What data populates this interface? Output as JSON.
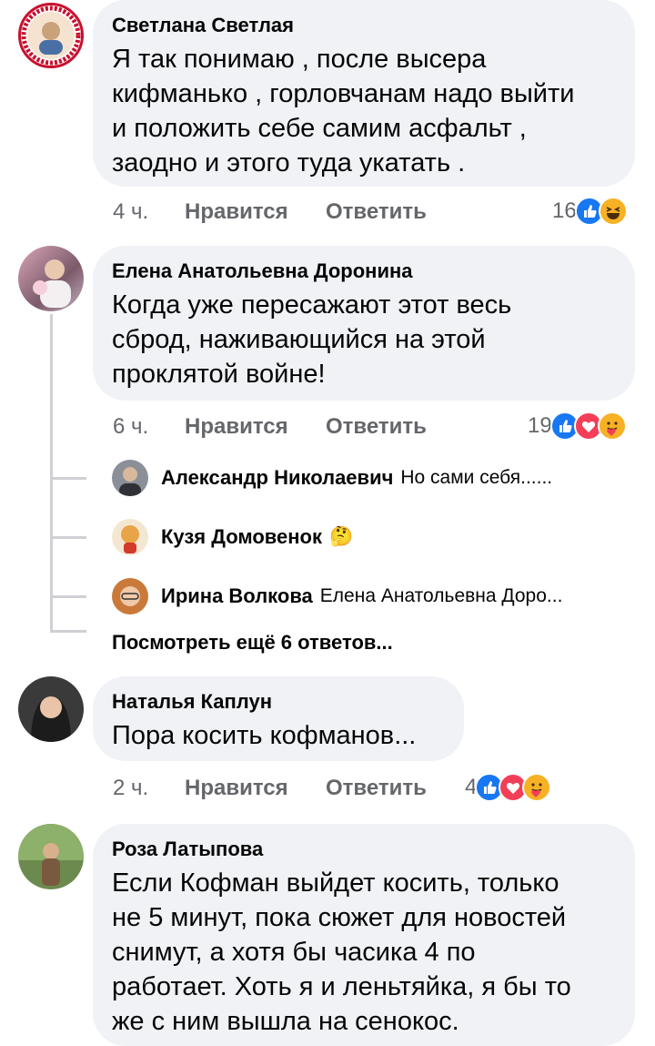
{
  "colors": {
    "bubble": "#f0f2f5",
    "meta": "#65676b",
    "like": "#1877f2",
    "love": "#f33e58",
    "haha": "#f7b125"
  },
  "comments": [
    {
      "author": "Светлана Светлая",
      "text": "Я так понимаю , после высера\nкифманько , горловчанам надо выйти\nи положить себе самим асфальт ,\nзаодно и этого туда укатать .",
      "time": "4 ч.",
      "like_label": "Нравится",
      "reply_label": "Ответить",
      "reaction_count": "16",
      "reactions": [
        "like-icon",
        "haha-icon"
      ]
    },
    {
      "author": "Елена Анатольевна Доронина",
      "text": "Когда уже пересажают этот весь\nсброд, наживающийся на этой\nпроклятой войне!",
      "time": "6 ч.",
      "like_label": "Нравится",
      "reply_label": "Ответить",
      "reaction_count": "19",
      "reactions": [
        "like-icon",
        "love-icon",
        "care-icon"
      ],
      "replies": [
        {
          "author": "Александр Николаевич",
          "text": "Но сами себя......"
        },
        {
          "author": "Кузя Домовенок",
          "text": "🤔"
        },
        {
          "author": "Ирина Волкова",
          "text": "Елена Анатольевна Доро..."
        }
      ],
      "more_replies": "Посмотреть ещё 6 ответов..."
    },
    {
      "author": "Наталья Каплун",
      "text": "Пора косить кофманов...",
      "time": "2 ч.",
      "like_label": "Нравится",
      "reply_label": "Ответить",
      "reaction_count": "4",
      "reactions": [
        "like-icon",
        "love-icon",
        "care-icon"
      ]
    },
    {
      "author": "Роза Латыпова",
      "text": "Если Кофман выйдет косить, только\nне 5 минут, пока сюжет для новостей\nснимут, а хотя бы часика 4 по\nработает. Хоть я и леньтяйка, я бы то\nже с ним вышла на сенокос."
    }
  ]
}
